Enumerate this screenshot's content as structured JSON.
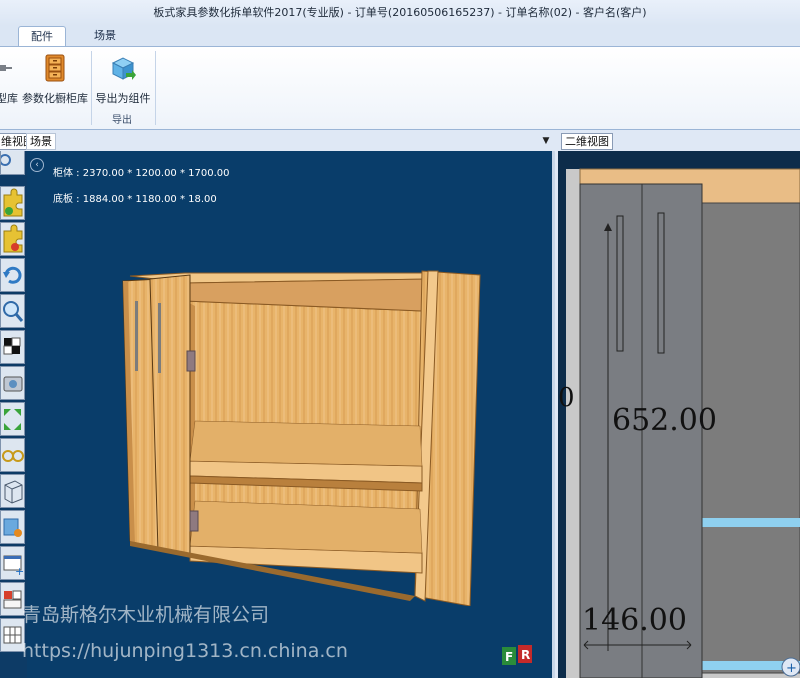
{
  "window": {
    "title": "板式家具参数化拆单软件2017(专业版) - 订单号(20160506165237) - 订单名称(02) - 客户名(客户)"
  },
  "tabs": [
    {
      "label": "配件"
    },
    {
      "label": "场景"
    }
  ],
  "ribbon": {
    "buttons": [
      {
        "label": "型库",
        "icon": "library-icon"
      },
      {
        "label": "参数化橱柜库",
        "icon": "cabinet-drawers-icon"
      },
      {
        "label": "导出为组件",
        "icon": "export-component-icon"
      }
    ],
    "group_label": "导出"
  },
  "panels": {
    "left_tab_partial": "维视图",
    "left_scene_tab": "场景",
    "right_tab": "二维视图"
  },
  "view3d": {
    "cabinet_info": "柜体 : 2370.00 * 1200.00 * 1700.00",
    "bottom_info": "底板 : 1884.00 * 1180.00 * 18.00",
    "toolbar_icons": [
      "puzzle-add-icon",
      "puzzle-remove-icon",
      "rotate-icon",
      "zoom-icon",
      "checker-icon",
      "camera-icon",
      "move-arrows-icon",
      "glasses-icon",
      "wireframe-icon",
      "material-icon",
      "window-add-icon",
      "layout-icon",
      "grid-icon"
    ]
  },
  "view2d": {
    "dim_height": "652.00",
    "dim_bottom": "146.00",
    "edge_text": "0"
  },
  "watermark": {
    "company": "青岛斯格尔木业机械有限公司",
    "url": "https://hujunping1313.cn.china.cn"
  },
  "colors": {
    "view_bg": "#093d6a",
    "wood": "#e8b56e",
    "panel_gray": "#777a7e"
  }
}
